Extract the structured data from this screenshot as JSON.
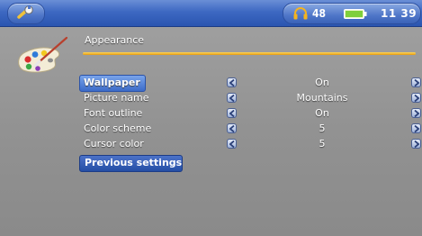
{
  "status_bar": {
    "tool_icon": "wrench-icon",
    "volume": "48",
    "headphone_icon": "headphone-icon",
    "battery_icon": "battery-icon",
    "time": "11 39"
  },
  "header": {
    "icon": "paint-palette-icon",
    "title": "Appearance"
  },
  "settings": [
    {
      "label": "Wallpaper",
      "value": "On"
    },
    {
      "label": "Picture name",
      "value": "Mountains"
    },
    {
      "label": "Font outline",
      "value": "On"
    },
    {
      "label": "Color scheme",
      "value": "5"
    },
    {
      "label": "Cursor color",
      "value": "5"
    }
  ],
  "selected_index": 0,
  "previous_settings_label": "Previous settings",
  "colors": {
    "accent": "#3c6bc9",
    "rule": "#e39a12",
    "background": "#929292"
  }
}
